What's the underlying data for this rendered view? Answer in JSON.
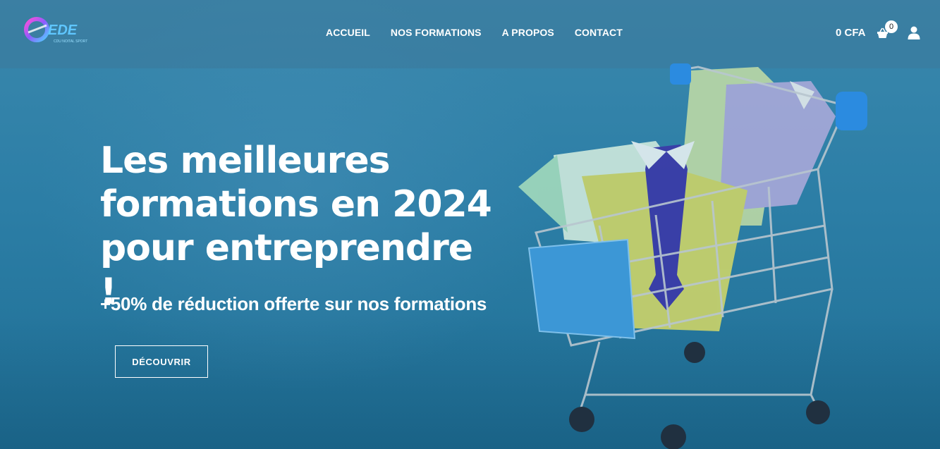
{
  "header": {
    "logo_text": "EDE",
    "logo_tagline": "CDU NOITAL SPORT",
    "nav": [
      {
        "label": "ACCUEIL"
      },
      {
        "label": "NOS FORMATIONS"
      },
      {
        "label": "A PROPOS"
      },
      {
        "label": "CONTACT"
      }
    ],
    "cart_total": "0 CFA",
    "cart_count": "0"
  },
  "hero": {
    "headline": "Les meilleures formations en 2024 pour entreprendre !",
    "subline": "+50% de réduction offerte sur nos formations",
    "cta_label": "DÉCOUVRIR"
  },
  "icons": {
    "basket": "shopping-basket-icon",
    "user": "user-icon"
  },
  "colors": {
    "background": "#2c7ea6",
    "text": "#ffffff"
  }
}
